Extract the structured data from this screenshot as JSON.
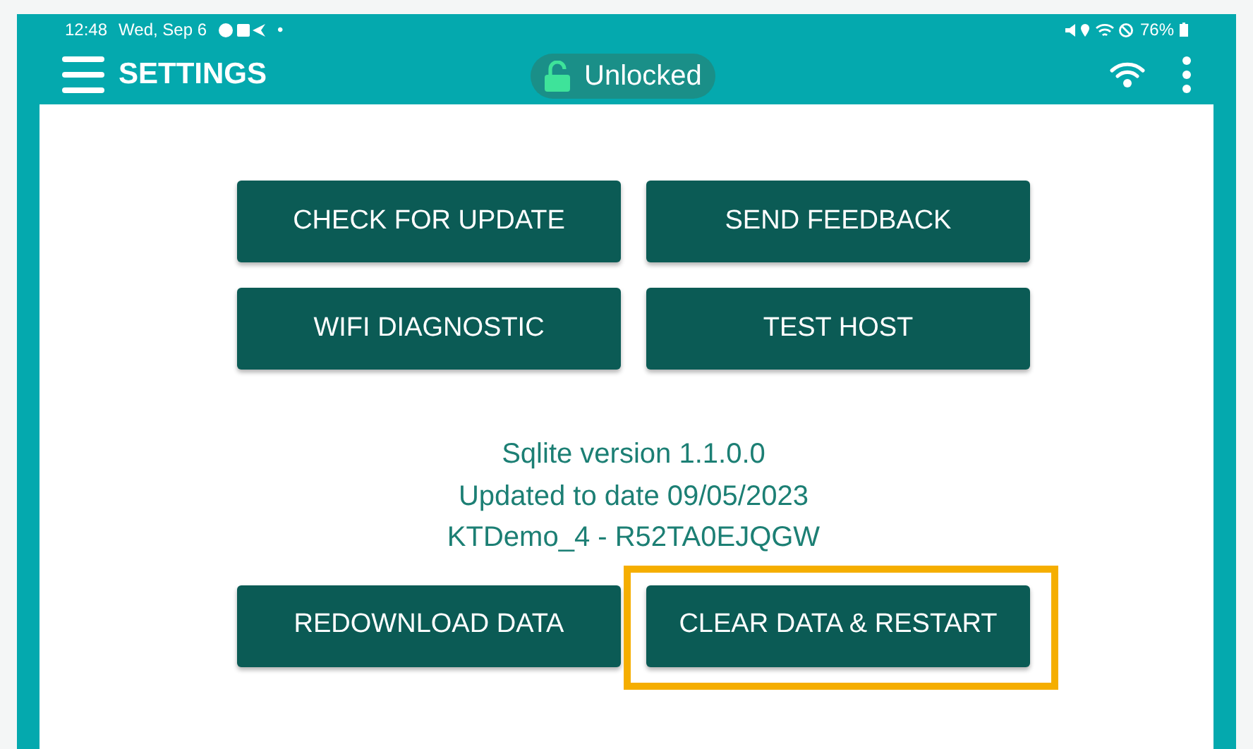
{
  "status_bar": {
    "time": "12:48",
    "date": "Wed, Sep 6",
    "dot": "•",
    "battery": "76%"
  },
  "header": {
    "title": "SETTINGS",
    "lock_status": "Unlocked"
  },
  "buttons": [
    {
      "label": "CHECK FOR UPDATE",
      "highlighted": false
    },
    {
      "label": "SEND FEEDBACK",
      "highlighted": false
    },
    {
      "label": "WIFI DIAGNOSTIC",
      "highlighted": false
    },
    {
      "label": "TEST HOST",
      "highlighted": false
    }
  ],
  "info_lines": [
    "Sqlite version 1.1.0.0",
    "Updated to date 09/05/2023",
    "KTDemo_4 - R52TA0EJQGW"
  ],
  "bottom_buttons": [
    {
      "label": "REDOWNLOAD DATA",
      "highlighted": false
    },
    {
      "label": "CLEAR DATA & RESTART",
      "highlighted": true
    }
  ]
}
